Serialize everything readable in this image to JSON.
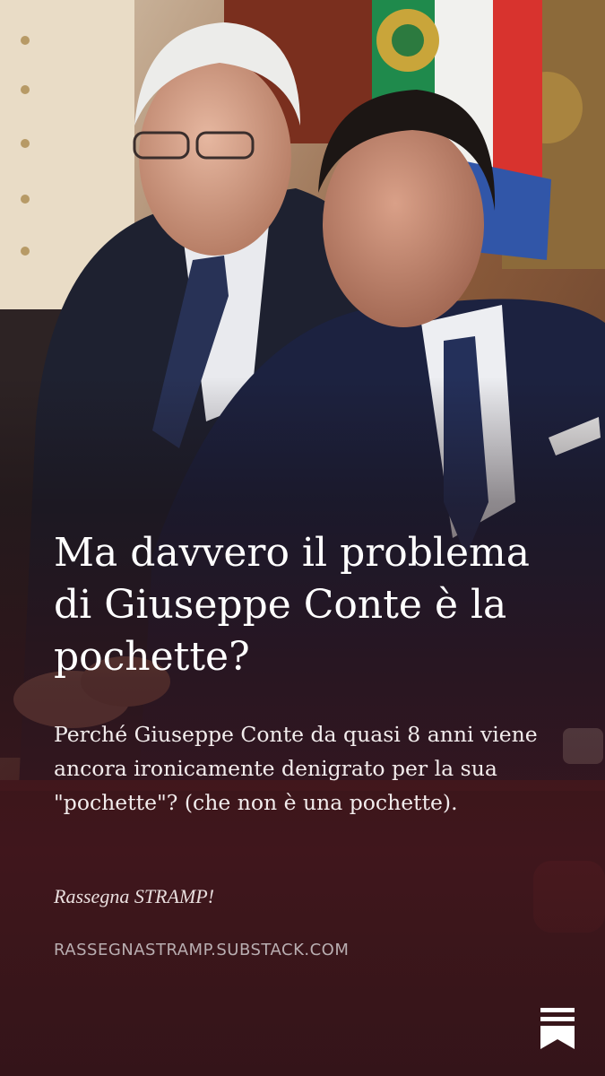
{
  "post": {
    "title": "Ma davvero il problema di Giuseppe Conte è la pochette?",
    "subtitle": "Perché Giuseppe Conte da quasi 8 anni viene ancora ironicamente denigrato per la sua \"pochette\"? (che non è una pochette).",
    "publication": "Rassegna STRAMP!",
    "domain": "RASSEGNASTRAMP.SUBSTACK.COM"
  },
  "icons": {
    "logo": "substack-logo-icon"
  },
  "colors": {
    "title_text": "#ffffff",
    "domain_text": "#b9aeb1",
    "overlay_tint": "#3c161c"
  }
}
